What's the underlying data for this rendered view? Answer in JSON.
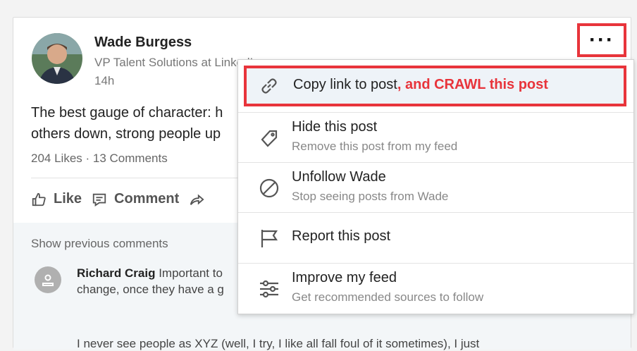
{
  "post": {
    "author_name": "Wade Burgess",
    "author_title": "VP Talent Solutions at LinkedIn",
    "time": "14h",
    "text_line1": "The best gauge of character: h",
    "text_line2": "others down, strong people up",
    "stats": "204 Likes · 13 Comments",
    "more_label": "···"
  },
  "actions": {
    "like": "Like",
    "comment": "Comment"
  },
  "comments": {
    "show_previous": "Show previous comments",
    "first_author": "Richard Craig",
    "first_text_line1": " Important to",
    "first_text_line2": "change, once they have a g",
    "more_text": "I never see people as XYZ (well, I try, I like all fall foul of it sometimes), I just"
  },
  "menu": {
    "copy_label": "Copy link to post",
    "copy_annotation": ", and CRAWL this post",
    "hide_label": "Hide this post",
    "hide_sub": "Remove this post from my feed",
    "unfollow_label": "Unfollow Wade",
    "unfollow_sub": "Stop seeing posts from Wade",
    "report_label": "Report this post",
    "improve_label": "Improve my feed",
    "improve_sub": "Get recommended sources to follow"
  },
  "colors": {
    "highlight_red": "#e8343b",
    "selected_bg": "#eef3f8"
  },
  "icons": {
    "copy": "link-icon",
    "hide": "tag-icon",
    "unfollow": "block-icon",
    "report": "flag-icon",
    "improve": "sliders-icon"
  }
}
